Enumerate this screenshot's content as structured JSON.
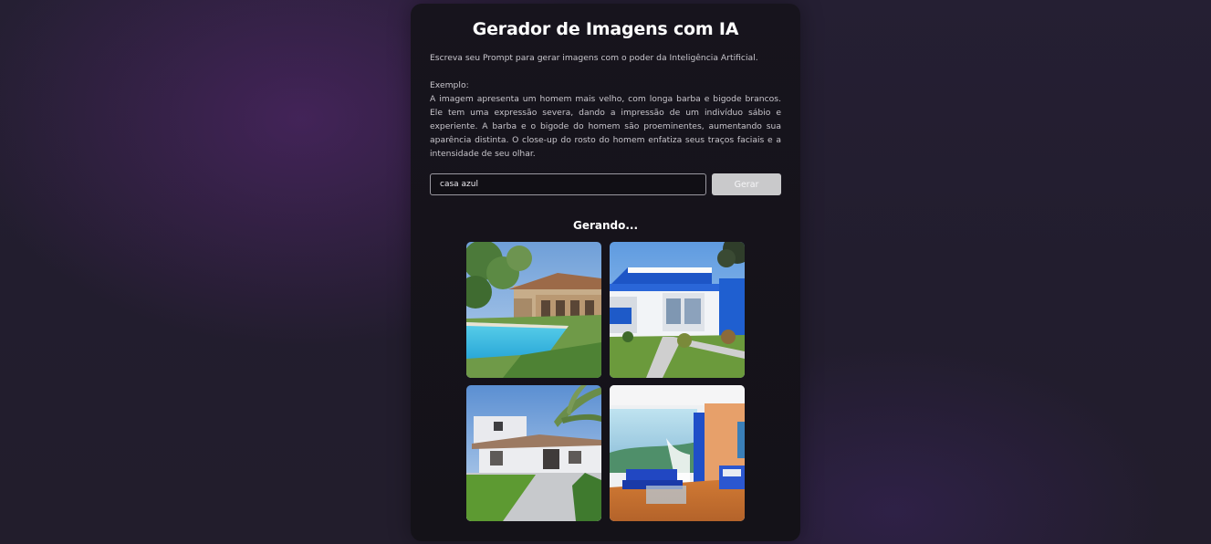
{
  "header": {
    "title": "Gerador de Imagens com IA"
  },
  "description": {
    "intro": "Escreva seu Prompt para gerar imagens com o poder da Inteligência Artificial.",
    "example_label": "Exemplo:",
    "example_text": "A imagem apresenta um homem mais velho, com longa barba e bigode brancos. Ele tem uma expressão severa, dando a impressão de um indivíduo sábio e experiente. A barba e o bigode do homem são proeminentes, aumentando sua aparência distinta. O close-up do rosto do homem enfatiza seus traços faciais e a intensidade de seu olhar."
  },
  "form": {
    "prompt_value": "casa azul",
    "button_label": "Gerar"
  },
  "results": {
    "status": "Gerando...",
    "images": [
      {
        "subject": "house-with-pool"
      },
      {
        "subject": "white-blue-house"
      },
      {
        "subject": "white-villa-with-palm"
      },
      {
        "subject": "blue-interior-room"
      }
    ]
  }
}
